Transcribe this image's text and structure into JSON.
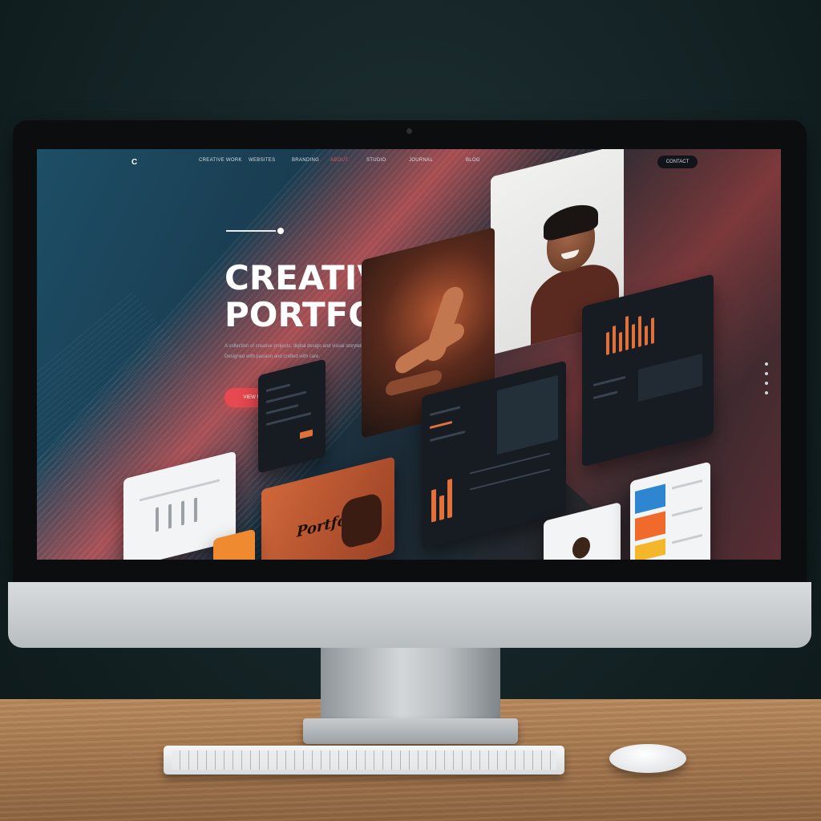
{
  "screen": {
    "nav": {
      "logo": "C",
      "links": [
        "CREATIVE WORK",
        "WEBSITES",
        "BRANDING",
        "ABOUT",
        "STUDIO",
        "JOURNAL",
        "BLOG"
      ],
      "active_index": 3,
      "cta_label": "CONTACT"
    },
    "hero": {
      "title_line1": "CREATIVE",
      "title_line2": "PORTFOIO",
      "description_line1": "A collection of creative projects, digital design and visual storytelling | Explore our work",
      "description_line2": "Designed with passion and crafted with care.",
      "button_label": "VIEW MORE"
    },
    "cards": {
      "orange_card_text": "Portfolio"
    },
    "scroll_dots_count": 4
  },
  "colors": {
    "accent_red": "#e6494f",
    "accent_orange": "#e2703a",
    "screen_bg_left": "#1d4e66",
    "screen_bg_right": "#5a2d33"
  }
}
